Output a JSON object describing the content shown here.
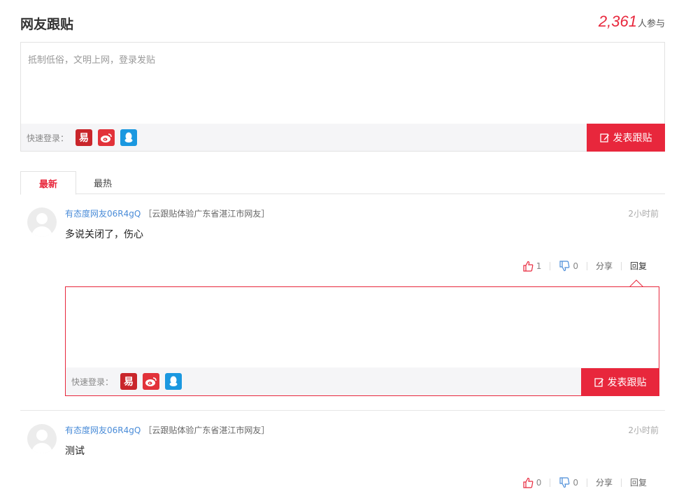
{
  "header": {
    "title": "网友跟贴",
    "count": "2,361",
    "count_suffix": "人参与"
  },
  "composer": {
    "placeholder": "抵制低俗，文明上网，登录发贴",
    "quick_login_label": "快速登录：",
    "submit_label": "发表跟贴"
  },
  "login_icons": [
    "netease-icon",
    "weibo-icon",
    "qq-icon"
  ],
  "tabs": [
    {
      "label": "最新",
      "active": true
    },
    {
      "label": "最热",
      "active": false
    }
  ],
  "comments": [
    {
      "user": "有态度网友06R4gQ",
      "location": "［云跟贴体验广东省湛江市网友］",
      "time": "2小时前",
      "text": "多说关闭了，伤心",
      "likes": "1",
      "dislikes": "0",
      "share": "分享",
      "reply": "回复"
    },
    {
      "user": "有态度网友06R4gQ",
      "location": "［云跟贴体验广东省湛江市网友］",
      "time": "2小时前",
      "text": "测试",
      "likes": "0",
      "dislikes": "0",
      "share": "分享",
      "reply": "回复"
    }
  ],
  "reply_box": {
    "quick_login_label": "快速登录：",
    "submit_label": "发表跟贴"
  },
  "colors": {
    "accent": "#e8273c",
    "link": "#4a8cd8",
    "qq": "#1b98e0"
  }
}
